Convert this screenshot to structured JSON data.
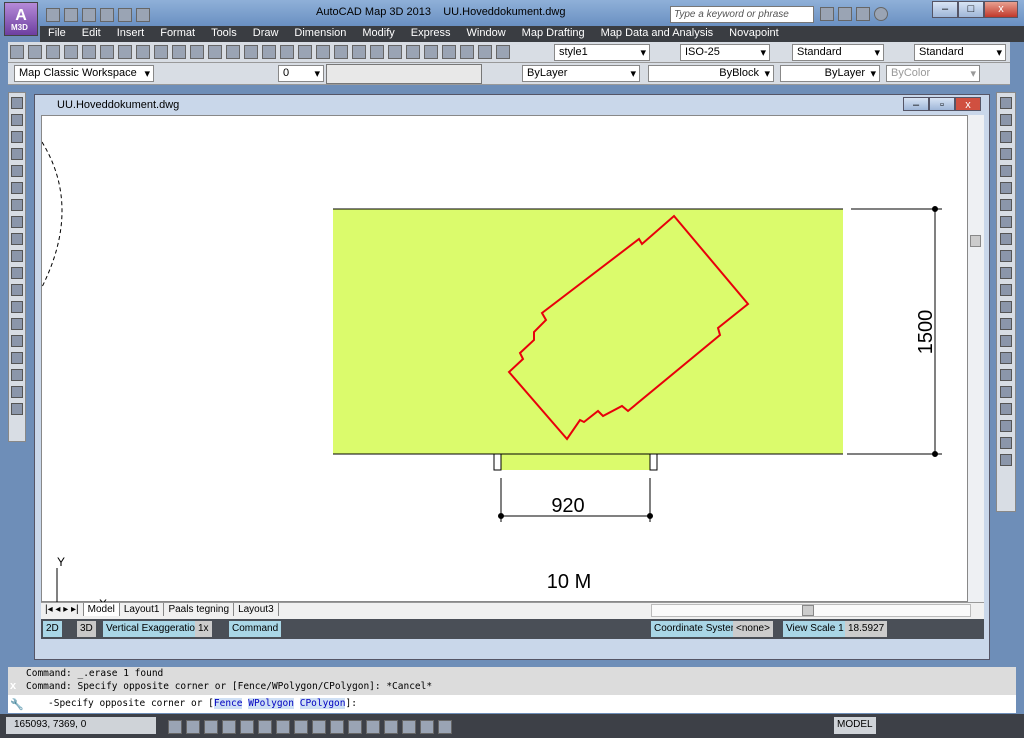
{
  "window": {
    "title": "AutoCAD Map 3D 2013",
    "document": "UU.Hoveddokument.dwg",
    "app_badge": "M3D",
    "search_placeholder": "Type a keyword or phrase"
  },
  "menu": [
    "File",
    "Edit",
    "Insert",
    "Format",
    "Tools",
    "Draw",
    "Dimension",
    "Modify",
    "Express",
    "Window",
    "Map Drafting",
    "Map Data and Analysis",
    "Novapoint"
  ],
  "toolbar1": {
    "text_style": "style1",
    "dim_style": "ISO-25",
    "table_style": "Standard",
    "mleader_style": "Standard"
  },
  "toolbar2": {
    "workspace": "Map Classic Workspace",
    "layer": "0",
    "color": "ByLayer",
    "linetype": "ByBlock",
    "lineweight": "ByLayer",
    "plotstyle": "ByColor"
  },
  "drawing": {
    "dim_vertical": "1500",
    "dim_horizontal": "920",
    "scale_label": "10 M",
    "ucs_y": "Y",
    "ucs_x": "X",
    "fill_color": "#dbfb6c",
    "outline_color": "#e8000b"
  },
  "layout_tabs": [
    "Model",
    "Layout1",
    "Paals tegning",
    "Layout3"
  ],
  "map_status": {
    "btn_2d": "2D",
    "btn_3d": "3D",
    "vertical_exaggeration_label": "Vertical Exaggeration:",
    "vertical_exaggeration": "1x",
    "command": "Command",
    "coord_system_label": "Coordinate System:",
    "coord_system": "<none>",
    "view_scale_label": "View Scale  1 :",
    "view_scale": "18.5927"
  },
  "command_history": [
    "Command: _.erase 1 found",
    "Command: Specify opposite corner or [Fence/WPolygon/CPolygon]: *Cancel*"
  ],
  "command_line": {
    "prefix": "-Specify opposite corner or [",
    "opt1": "Fence",
    "opt2": "WPolygon",
    "opt3": "CPolygon",
    "suffix": "]:"
  },
  "statusbar": {
    "coordinates": "165093, 7369, 0",
    "model": "MODEL"
  }
}
